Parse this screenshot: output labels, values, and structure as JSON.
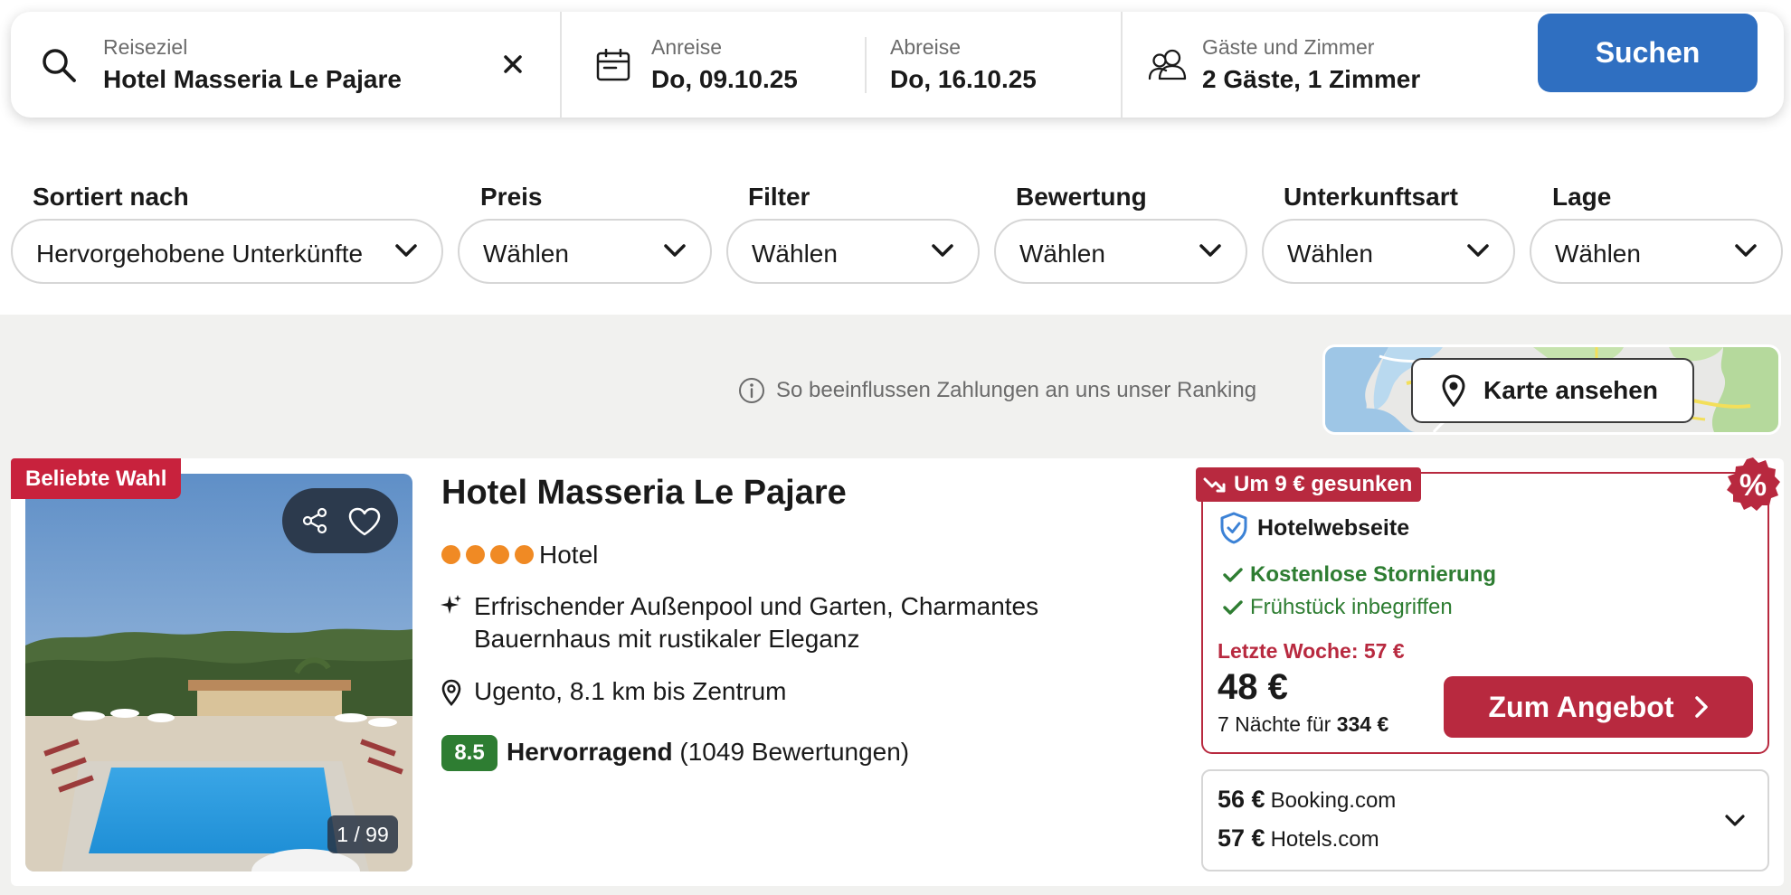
{
  "search": {
    "destination_label": "Reiseziel",
    "destination_value": "Hotel Masseria Le Pajare",
    "checkin_label": "Anreise",
    "checkin_value": "Do, 09.10.25",
    "checkout_label": "Abreise",
    "checkout_value": "Do, 16.10.25",
    "guests_label": "Gäste und Zimmer",
    "guests_value": "2 Gäste, 1 Zimmer",
    "search_button": "Suchen"
  },
  "filters": [
    {
      "label": "Sortiert nach",
      "value": "Hervorgehobene Unterkünfte"
    },
    {
      "label": "Preis",
      "value": "Wählen"
    },
    {
      "label": "Filter",
      "value": "Wählen"
    },
    {
      "label": "Bewertung",
      "value": "Wählen"
    },
    {
      "label": "Unterkunftsart",
      "value": "Wählen"
    },
    {
      "label": "Lage",
      "value": "Wählen"
    }
  ],
  "ranking_note": "So beeinflussen Zahlungen an uns unser Ranking",
  "map_button": "Karte ansehen",
  "hotel": {
    "badge": "Beliebte Wahl",
    "photo_counter": "1 / 99",
    "name": "Hotel Masseria Le Pajare",
    "stars": 4,
    "type": "Hotel",
    "highlight": "Erfrischender Außenpool und Garten, Charmantes Bauernhaus mit rustikaler Eleganz",
    "location": "Ugento, 8.1 km bis Zentrum",
    "score": "8.5",
    "rating_word": "Hervorragend",
    "rating_count": "(1049 Bewertungen)"
  },
  "offer": {
    "price_drop": "Um 9 € gesunken",
    "discount_symbol": "%",
    "provider": "Hotelwebseite",
    "feature_1": "Kostenlose Stornierung",
    "feature_2": "Frühstück inbegriffen",
    "last_week": "Letzte Woche: 57 €",
    "price": "48 €",
    "total_prefix": "7 Nächte für",
    "total_value": "334 €",
    "cta": "Zum Angebot"
  },
  "other_prices": [
    {
      "price": "56 €",
      "provider": "Booking.com"
    },
    {
      "price": "57 €",
      "provider": "Hotels.com"
    }
  ],
  "colors": {
    "primary_blue": "#2f6fc1",
    "deal_red": "#b8293f",
    "badge_red": "#c8223d",
    "star_orange": "#f08a24",
    "score_green": "#2e7d32"
  }
}
